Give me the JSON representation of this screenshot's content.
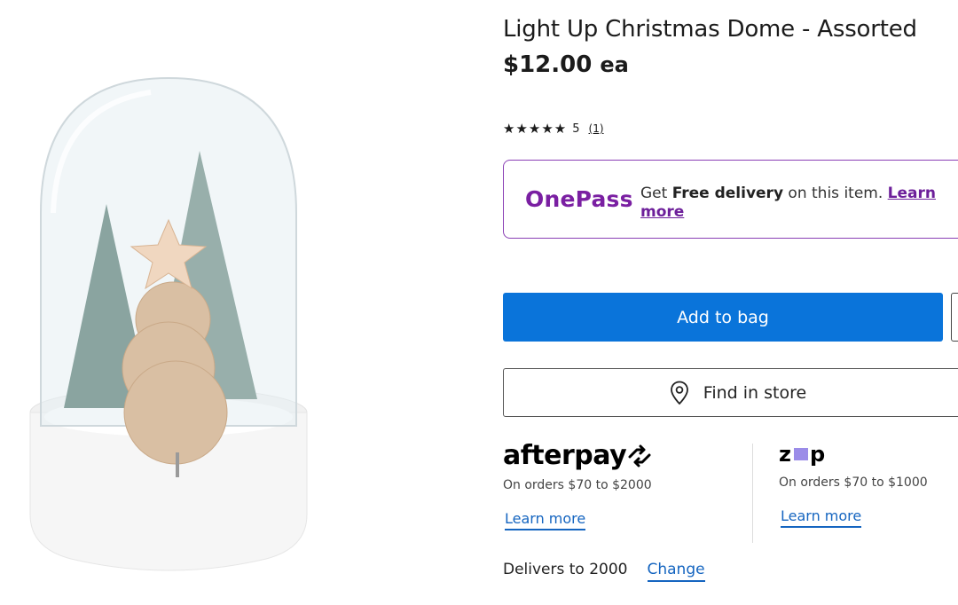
{
  "product": {
    "title": "Light Up Christmas Dome - Assorted",
    "price": "$12.00",
    "price_unit": "ea",
    "rating": {
      "stars": "★★★★★",
      "score": "5",
      "count": "(1)"
    },
    "image_alt": "Light up Christmas dome with trees and wooden star"
  },
  "onepass": {
    "logo": "OnePass",
    "text_prefix": "Get ",
    "text_bold": "Free delivery",
    "text_suffix": " on this item. ",
    "learn_more": "Learn more"
  },
  "actions": {
    "add_to_bag": "Add to bag",
    "find_in_store": "Find in store"
  },
  "payments": {
    "afterpay": {
      "logo": "afterpay",
      "sub": "On orders $70 to $2000",
      "learn": "Learn more"
    },
    "zip": {
      "logo_z": "z",
      "logo_p": "p",
      "sub": "On orders $70 to $1000",
      "learn": "Learn more"
    }
  },
  "delivery": {
    "text": "Delivers to 2000",
    "change": "Change"
  },
  "colors": {
    "primary_blue": "#0a74da",
    "onepass_purple": "#7a1fa2",
    "link_blue": "#1565c0"
  }
}
